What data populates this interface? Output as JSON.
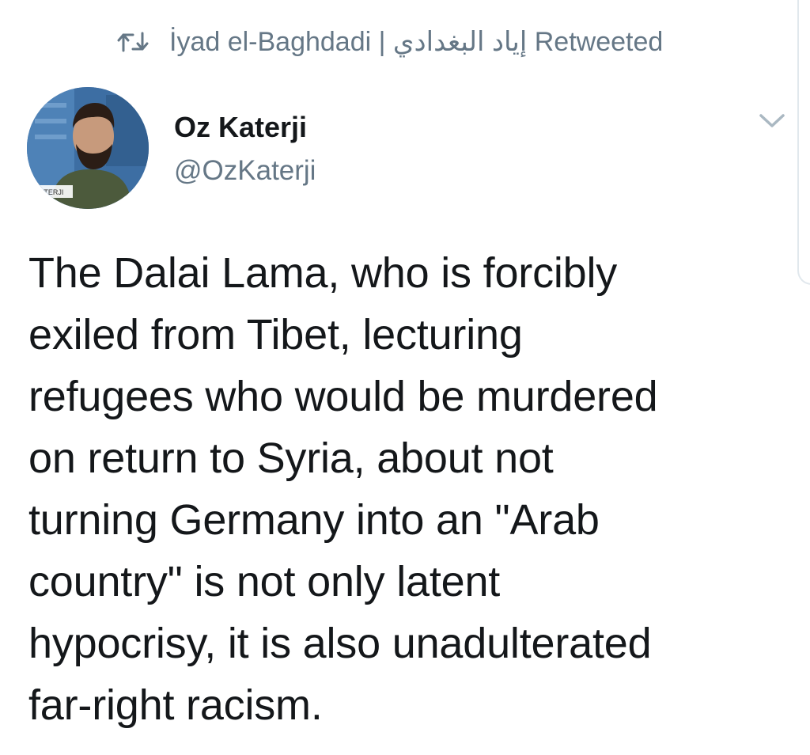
{
  "retweet_banner": {
    "retweeter_name": "İyad el-Baghdadi | إياد البغدادي",
    "action_label": "Retweeted",
    "icon": "retweet-icon"
  },
  "author": {
    "display_name": "Oz Katerji",
    "handle": "@OzKaterji",
    "avatar_caption": "KATERJI"
  },
  "menu": {
    "icon": "chevron-down-icon"
  },
  "tweet": {
    "lines": [
      "The Dalai Lama, who is forcibly",
      "exiled from Tibet, lecturing",
      "refugees who would be murdered",
      "on return to Syria, about not",
      "turning Germany into an \"Arab",
      "country\" is not only latent",
      "hypocrisy, it is also unadulterated",
      "far-right racism."
    ]
  },
  "colors": {
    "text_primary": "#14171a",
    "text_secondary": "#657786",
    "divider": "#e1e8ed"
  }
}
